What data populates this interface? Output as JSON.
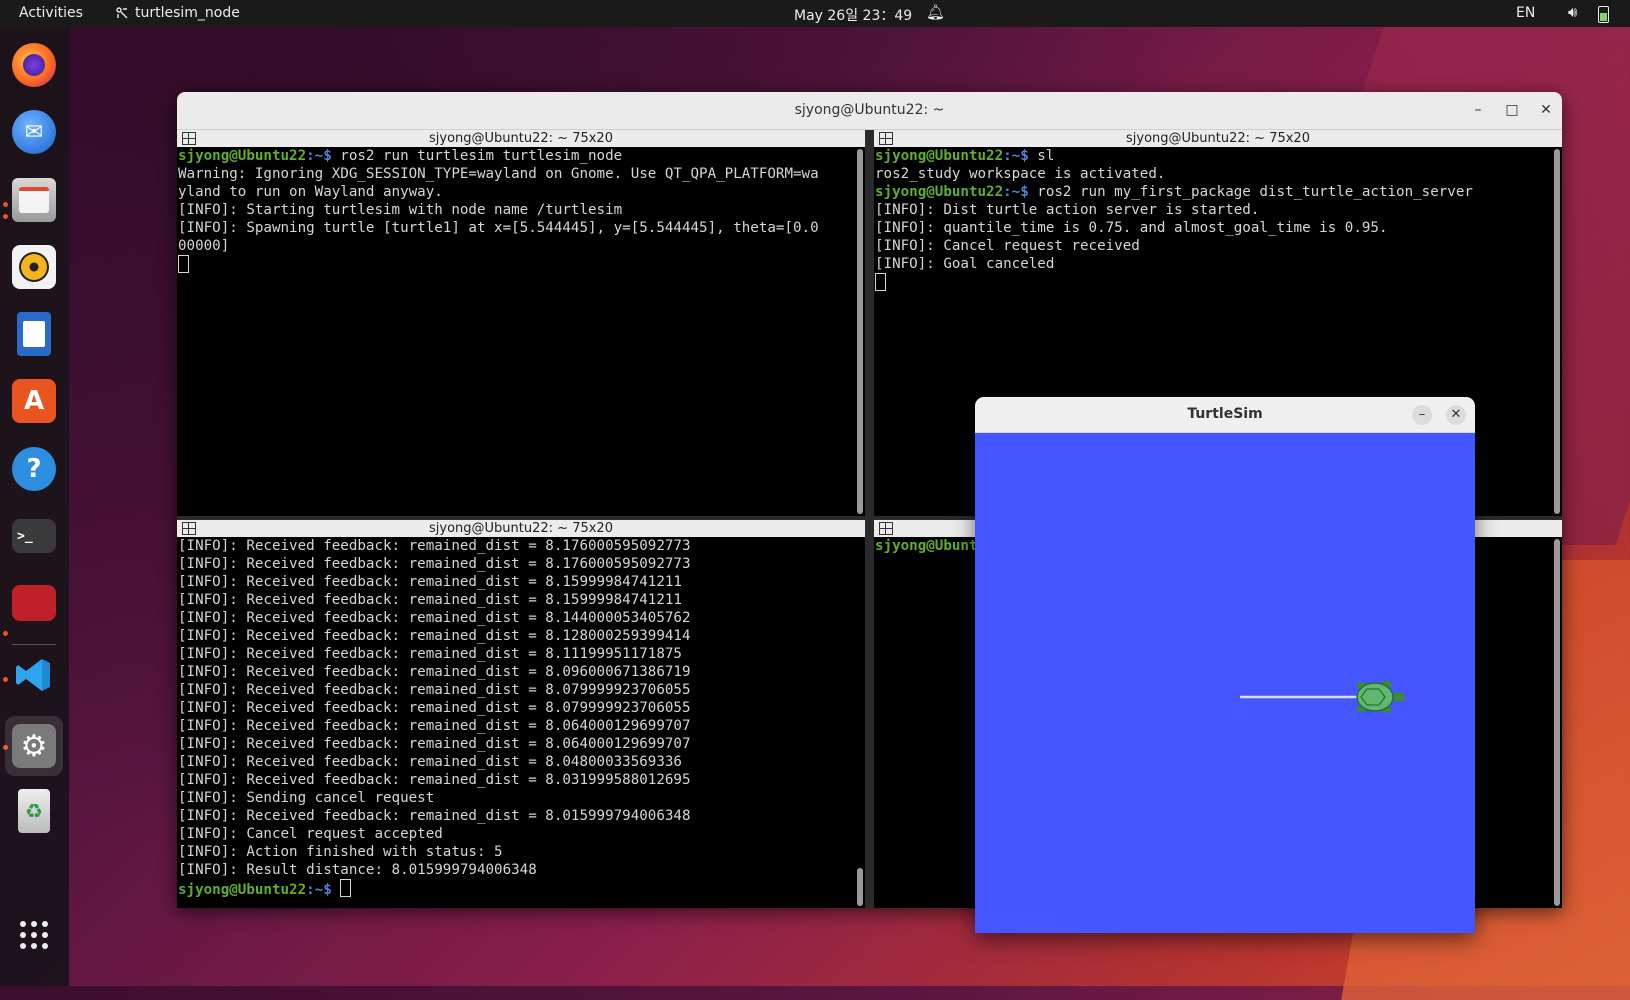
{
  "topbar": {
    "activities": "Activities",
    "app_name": "turtlesim_node",
    "clock": "May 26일  23：49",
    "lang": "EN"
  },
  "dock": {
    "items": [
      {
        "name": "firefox-icon"
      },
      {
        "name": "thunderbird-icon"
      },
      {
        "name": "files-icon"
      },
      {
        "name": "rhythmbox-icon"
      },
      {
        "name": "libreoffice-writer-icon"
      },
      {
        "name": "app-center-icon"
      },
      {
        "name": "help-icon"
      },
      {
        "name": "terminal-icon"
      },
      {
        "name": "terminator-icon"
      },
      {
        "name": "vscode-icon"
      },
      {
        "name": "settings-icon"
      },
      {
        "name": "trash-icon"
      },
      {
        "name": "show-apps-icon"
      }
    ],
    "accent": "#e95420"
  },
  "terminal_window": {
    "title": "sjyong@Ubuntu22: ~",
    "panes": {
      "top_left": {
        "title": "sjyong@Ubuntu22: ~ 75x20",
        "prompt_user": "sjyong@Ubuntu22",
        "prompt_path": ":~$ ",
        "command": "ros2 run turtlesim turtlesim_node",
        "lines": [
          "Warning: Ignoring XDG_SESSION_TYPE=wayland on Gnome. Use QT_QPA_PLATFORM=wa",
          "yland to run on Wayland anyway.",
          "[INFO]: Starting turtlesim with node name /turtlesim",
          "[INFO]: Spawning turtle [turtle1] at x=[5.544445], y=[5.544445], theta=[0.0",
          "00000]"
        ]
      },
      "top_right": {
        "title": "sjyong@Ubuntu22: ~ 75x20",
        "prompt_user": "sjyong@Ubuntu22",
        "prompt_path": ":~$ ",
        "command1": "sl",
        "line1": "ros2_study workspace is activated.",
        "command2": "ros2 run my_first_package dist_turtle_action_server",
        "lines": [
          "[INFO]: Dist turtle action server is started.",
          "[INFO]: quantile_time is 0.75. and almost_goal_time is 0.95.",
          "[INFO]: Cancel request received",
          "[INFO]: Goal canceled"
        ]
      },
      "bottom_left": {
        "title": "sjyong@Ubuntu22: ~ 75x20",
        "lines": [
          "[INFO]: Received feedback: remained_dist = 8.176000595092773",
          "[INFO]: Received feedback: remained_dist = 8.176000595092773",
          "[INFO]: Received feedback: remained_dist = 8.15999984741211",
          "[INFO]: Received feedback: remained_dist = 8.15999984741211",
          "[INFO]: Received feedback: remained_dist = 8.144000053405762",
          "[INFO]: Received feedback: remained_dist = 8.128000259399414",
          "[INFO]: Received feedback: remained_dist = 8.11199951171875",
          "[INFO]: Received feedback: remained_dist = 8.096000671386719",
          "[INFO]: Received feedback: remained_dist = 8.079999923706055",
          "[INFO]: Received feedback: remained_dist = 8.079999923706055",
          "[INFO]: Received feedback: remained_dist = 8.064000129699707",
          "[INFO]: Received feedback: remained_dist = 8.064000129699707",
          "[INFO]: Received feedback: remained_dist = 8.04800033569336",
          "[INFO]: Received feedback: remained_dist = 8.031999588012695",
          "[INFO]: Sending cancel request",
          "[INFO]: Received feedback: remained_dist = 8.015999794006348",
          "[INFO]: Cancel request accepted",
          "[INFO]: Action finished with status: 5",
          "[INFO]: Result distance: 8.015999794006348"
        ],
        "prompt_user": "sjyong@Ubuntu22",
        "prompt_path": ":~$ "
      },
      "bottom_right": {
        "prompt_user": "sjyong@Ubuntu"
      }
    }
  },
  "turtlesim": {
    "title": "TurtleSim",
    "background": "#4556ff"
  }
}
